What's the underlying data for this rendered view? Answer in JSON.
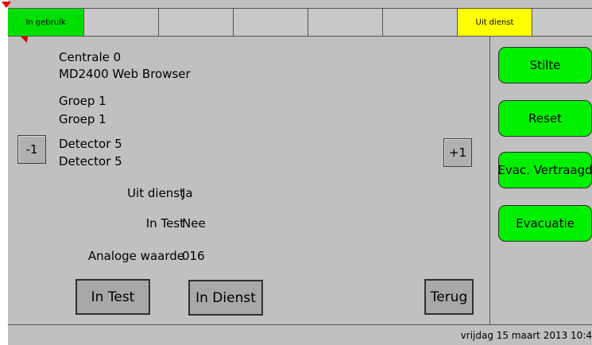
{
  "status_strip": {
    "cells": [
      {
        "label": "In gebruik",
        "color": "#00e000"
      },
      {
        "label": "",
        "color": ""
      },
      {
        "label": "",
        "color": ""
      },
      {
        "label": "",
        "color": ""
      },
      {
        "label": "",
        "color": ""
      },
      {
        "label": "",
        "color": ""
      },
      {
        "label": "Uit dienst",
        "color": "#ffff00"
      },
      {
        "label": "",
        "color": ""
      }
    ]
  },
  "info": {
    "centrale": "Centrale 0",
    "browser": "MD2400 Web Browser",
    "groep_1": "Groep 1",
    "groep_2": "Groep 1",
    "detector_1": "Detector 5",
    "detector_2": "Detector 5"
  },
  "nav": {
    "minus_label": "-1",
    "plus_label": "+1"
  },
  "fields": {
    "uit_dienst_label": "Uit dienst",
    "uit_dienst_value": "Ja",
    "in_test_label": "In Test",
    "in_test_value": "Nee",
    "analoge_label": "Analoge waarde",
    "analoge_value": "016"
  },
  "actions": {
    "in_test": "In Test",
    "in_dienst": "In Dienst",
    "terug": "Terug"
  },
  "side_buttons": {
    "stilte": "Stilte",
    "reset": "Reset",
    "evac_vertraagd": "Evac. Vertraagd",
    "evacuatie": "Evacuatie"
  },
  "footer": {
    "datetime": "vrijdag 15 maart 2013 10:4"
  },
  "colors": {
    "accent_green": "#00f000",
    "status_yellow": "#ffff00",
    "panel_gray": "#c0c0c0"
  }
}
